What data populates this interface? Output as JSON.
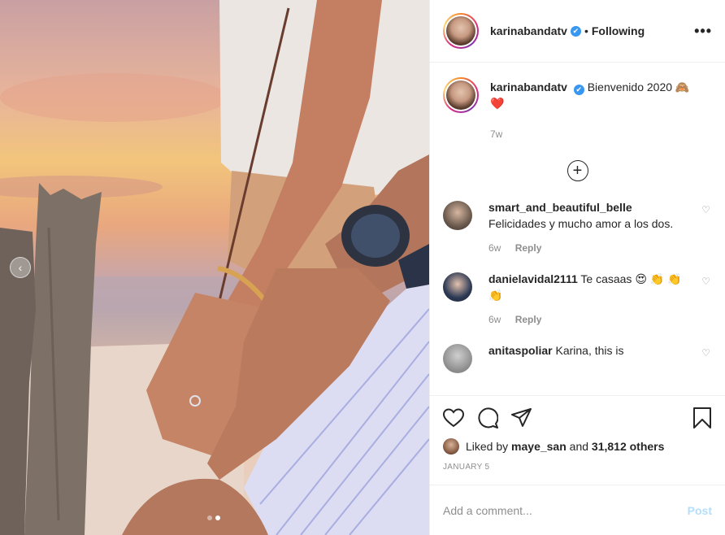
{
  "header": {
    "username": "karinabandatv",
    "verified_mark": "✔",
    "separator": "•",
    "follow_status": "Following",
    "more_label": "•••"
  },
  "caption": {
    "username": "karinabandatv",
    "text": "Bienvenido 2020 🙈",
    "emoji_line": "❤️",
    "time": "7w"
  },
  "load_more_icon": "+",
  "comments": [
    {
      "username": "smart_and_beautiful_belle",
      "text": "Felicidades y mucho amor a los dos.",
      "time": "6w",
      "reply_label": "Reply",
      "avatar_color": "#6b5a4e"
    },
    {
      "username": "danielavidal2111",
      "text": "Te casaas 😍 👏 👏👏",
      "time": "6w",
      "reply_label": "Reply",
      "avatar_color": "#2d3a55"
    },
    {
      "username": "anitaspoliar",
      "text": "Karina, this is",
      "time": "",
      "reply_label": "",
      "avatar_color": "#8a8a8a"
    }
  ],
  "likes": {
    "prefix": "Liked by",
    "user": "maye_san",
    "joiner": "and",
    "others": "31,812 others"
  },
  "date": "JANUARY 5",
  "add_comment": {
    "placeholder": "Add a comment...",
    "post_label": "Post"
  },
  "carousel": {
    "prev_icon": "‹",
    "current": 2,
    "total": 2
  },
  "icons": {
    "like": "heart-icon",
    "comment": "comment-icon",
    "share": "share-icon",
    "save": "bookmark-icon"
  },
  "colors": {
    "verified": "#3897f0",
    "post_disabled": "#b2dffc",
    "muted": "#8e8e8e"
  }
}
